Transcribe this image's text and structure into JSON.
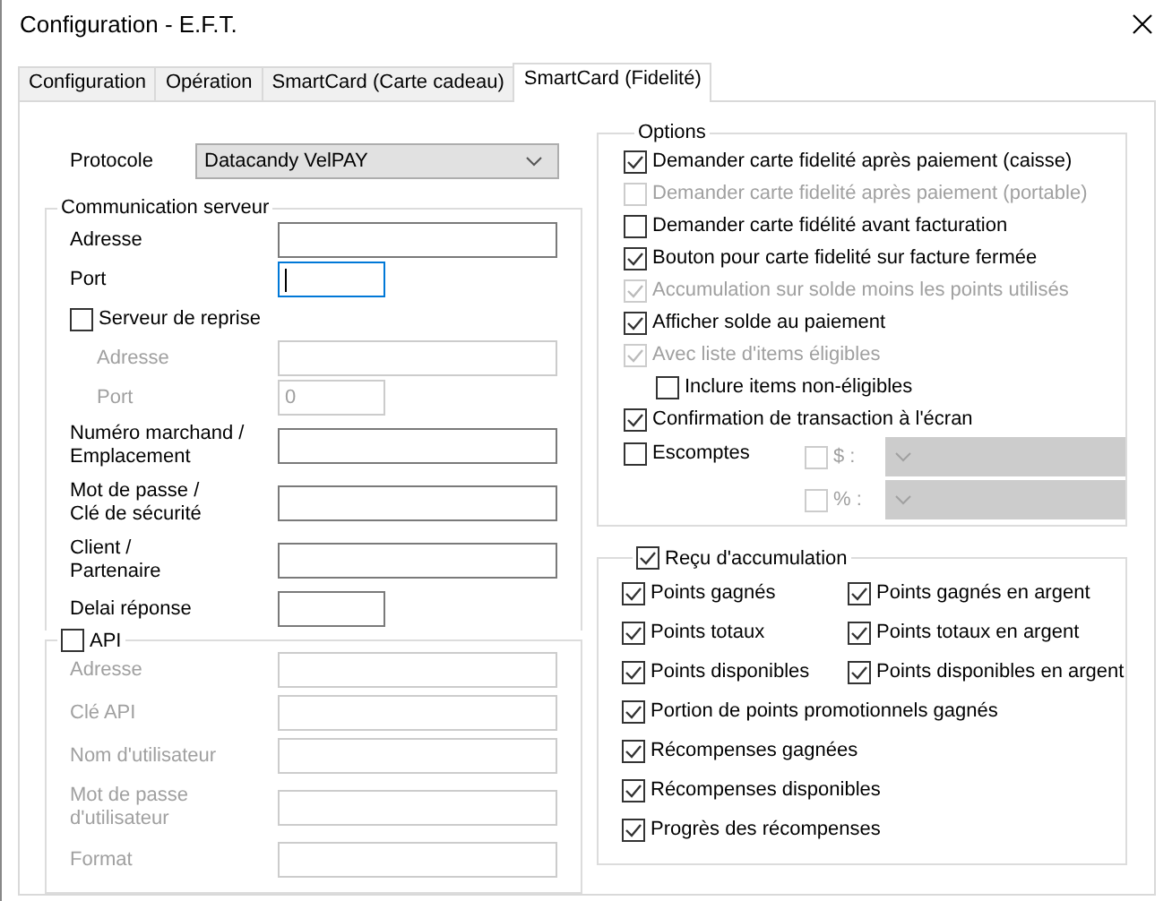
{
  "window": {
    "title": "Configuration - E.F.T."
  },
  "tabs": [
    {
      "label": "Configuration",
      "selected": false
    },
    {
      "label": "Opération",
      "selected": false
    },
    {
      "label": "SmartCard (Carte cadeau)",
      "selected": false
    },
    {
      "label": "SmartCard (Fidelité)",
      "selected": true
    }
  ],
  "protocol": {
    "label": "Protocole",
    "value": "Datacandy VelPAY"
  },
  "communication": {
    "title": "Communication serveur",
    "items": [
      {
        "kind": "field",
        "label": "Adresse",
        "disabled": false,
        "focused": false
      },
      {
        "kind": "short_field",
        "label": "Port",
        "disabled": false,
        "focused": true
      },
      {
        "kind": "checkbox",
        "label": "Serveur de reprise",
        "checked": false,
        "disabled": false,
        "children": [
          {
            "kind": "field",
            "label": "Adresse",
            "disabled": true,
            "focused": false
          },
          {
            "kind": "short_field",
            "label": "Port",
            "value": "0",
            "disabled": true,
            "focused": false
          }
        ]
      },
      {
        "kind": "field",
        "label": "Numéro marchand /\nEmplacement",
        "disabled": false,
        "focused": false
      },
      {
        "kind": "field",
        "label": "Mot de passe /\nClé de sécurité",
        "disabled": false,
        "focused": false
      },
      {
        "kind": "field",
        "label": "Client /\nPartenaire",
        "disabled": false,
        "focused": false
      },
      {
        "kind": "short_field",
        "label": "Delai réponse",
        "disabled": false,
        "focused": false
      }
    ]
  },
  "api": {
    "title": "API",
    "checked": false,
    "fields": [
      {
        "label": "Adresse",
        "disabled": true
      },
      {
        "label": "Clé API",
        "disabled": true
      },
      {
        "label": "Nom d'utilisateur",
        "disabled": true
      },
      {
        "label": "Mot de passe\nd'utilisateur",
        "disabled": true
      },
      {
        "label": "Format",
        "disabled": true
      }
    ]
  },
  "options": {
    "title": "Options",
    "items": [
      {
        "kind": "checkbox",
        "label": "Demander carte fidelité après paiement (caisse)",
        "checked": true,
        "disabled": false
      },
      {
        "kind": "checkbox",
        "label": "Demander carte fidelité après paiement (portable)",
        "checked": false,
        "disabled": true
      },
      {
        "kind": "checkbox",
        "label": "Demander carte fidélité avant facturation",
        "checked": false,
        "disabled": false
      },
      {
        "kind": "checkbox",
        "label": "Bouton pour carte fidelité sur facture fermée",
        "checked": true,
        "disabled": false
      },
      {
        "kind": "checkbox",
        "label": "Accumulation sur solde moins les points utilisés",
        "checked": true,
        "disabled": true
      },
      {
        "kind": "checkbox",
        "label": "Afficher solde au paiement",
        "checked": true,
        "disabled": false
      },
      {
        "kind": "checkbox",
        "label": "Avec liste d'items éligibles",
        "checked": true,
        "disabled": true,
        "children": [
          {
            "kind": "checkbox",
            "label": "Inclure items non-éligibles",
            "checked": false,
            "disabled": false
          }
        ]
      },
      {
        "kind": "checkbox",
        "label": "Confirmation de transaction à l'écran",
        "checked": true,
        "disabled": false
      },
      {
        "kind": "discount",
        "label": "Escomptes",
        "checked": false,
        "disabled": false,
        "choices": [
          {
            "label": "$ :",
            "checked": false,
            "disabled": true
          },
          {
            "label": "% :",
            "checked": false,
            "disabled": true
          }
        ]
      }
    ]
  },
  "receipt": {
    "title": "Reçu d'accumulation",
    "checked": true,
    "rows": [
      [
        {
          "label": "Points gagnés",
          "checked": true
        },
        {
          "label": "Points gagnés en argent",
          "checked": true
        }
      ],
      [
        {
          "label": "Points totaux",
          "checked": true
        },
        {
          "label": "Points totaux en argent",
          "checked": true
        }
      ],
      [
        {
          "label": "Points disponibles",
          "checked": true
        },
        {
          "label": "Points disponibles en argent",
          "checked": true
        }
      ],
      [
        {
          "label": "Portion de points promotionnels gagnés",
          "checked": true
        }
      ],
      [
        {
          "label": "Récompenses gagnées",
          "checked": true
        }
      ],
      [
        {
          "label": "Récompenses disponibles",
          "checked": true
        }
      ],
      [
        {
          "label": "Progrès des récompenses",
          "checked": true
        }
      ]
    ]
  }
}
